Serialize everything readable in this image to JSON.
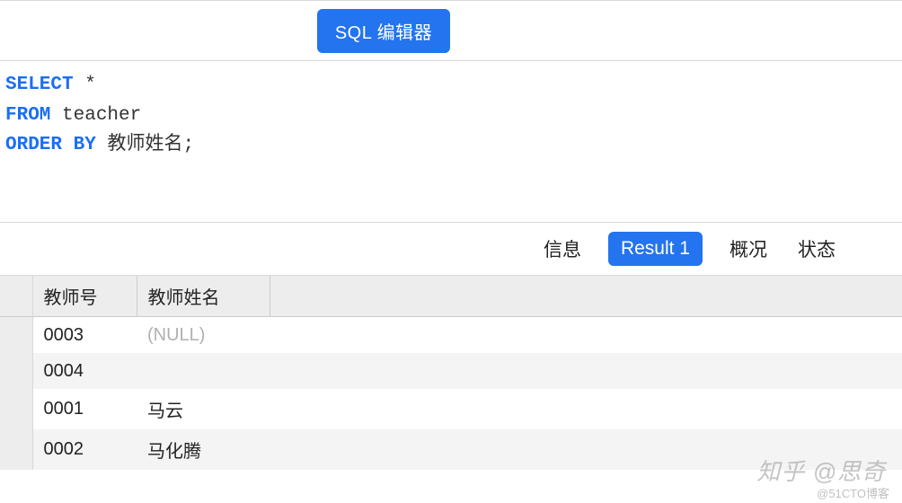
{
  "toolbar": {
    "sql_editor_label": "SQL 编辑器"
  },
  "sql": {
    "tokens": [
      {
        "text": "SELECT",
        "class": "kw"
      },
      {
        "text": " *",
        "class": "txt"
      },
      {
        "text": "\n",
        "class": "txt"
      },
      {
        "text": "FROM",
        "class": "kw"
      },
      {
        "text": " teacher",
        "class": "txt"
      },
      {
        "text": "\n",
        "class": "txt"
      },
      {
        "text": "ORDER",
        "class": "kw"
      },
      {
        "text": " ",
        "class": "txt"
      },
      {
        "text": "BY",
        "class": "kw"
      },
      {
        "text": " 教师姓名;",
        "class": "txt"
      }
    ]
  },
  "tabs": {
    "info": "信息",
    "result": "Result 1",
    "profile": "概况",
    "status": "状态"
  },
  "table": {
    "columns": {
      "id": "教师号",
      "name": "教师姓名"
    },
    "rows": [
      {
        "id": "0003",
        "name": "(NULL)",
        "is_null": true
      },
      {
        "id": "0004",
        "name": "",
        "is_null": false
      },
      {
        "id": "0001",
        "name": "马云",
        "is_null": false
      },
      {
        "id": "0002",
        "name": "马化腾",
        "is_null": false
      }
    ]
  },
  "watermark": {
    "zhihu": "知乎 @思奇",
    "cto": "@51CTO博客"
  }
}
